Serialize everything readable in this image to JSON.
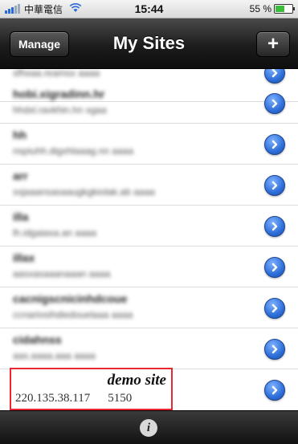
{
  "status_bar": {
    "carrier": "中華電信",
    "time": "15:44",
    "battery_text": "55 %",
    "battery_level": 0.55
  },
  "nav": {
    "title": "My Sites",
    "manage_label": "Manage",
    "add_label": "+"
  },
  "sites": [
    {
      "name": "",
      "detail": "sfhxaa.reamsx    aaaa"
    },
    {
      "name": "hobi.xigradinn.hr",
      "detail": "hhdxl.ravkhin.hn    xgaa"
    },
    {
      "name": "hh",
      "detail": "nspiuhh.digxhlaaag.nn    aaaa"
    },
    {
      "name": "arr",
      "detail": "ssjaaansasaaugkgkiolak.ab    aaaa"
    },
    {
      "name": "illa",
      "detail": "lh.idgaiasa.an    aaaa"
    },
    {
      "name": "illax",
      "detail": "aasxasaaanaaan    aaaa"
    },
    {
      "name": "cacnigscnicinhdcoue",
      "detail": "ccnariosihdiedouelaaa    aaaa"
    },
    {
      "name": "cidahnss",
      "detail": "aas.aaaa.aaa    aaaa"
    }
  ],
  "demo_site": {
    "name": "demo site",
    "host": "220.135.38.117",
    "port": "5150"
  },
  "toolbar": {
    "info_icon": "i"
  }
}
